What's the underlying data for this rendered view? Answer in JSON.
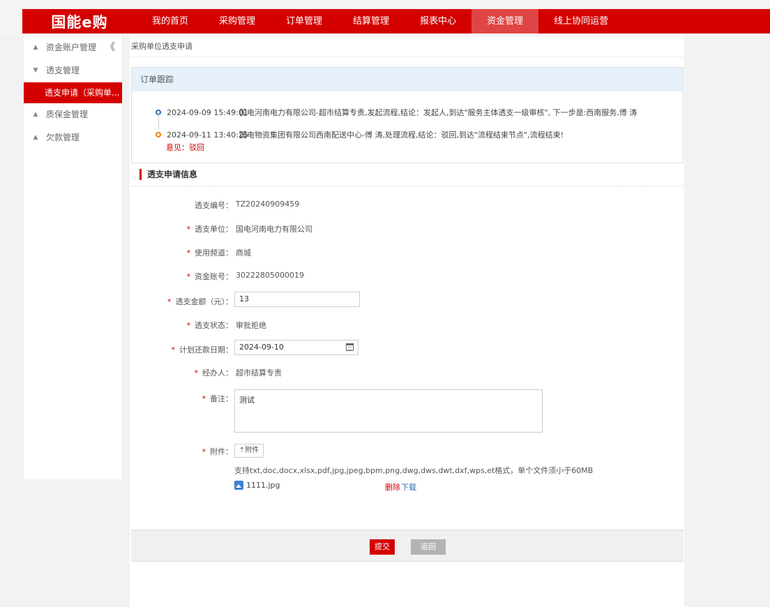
{
  "nav": {
    "logo": "国能e购",
    "items": [
      "我的首页",
      "采购管理",
      "订单管理",
      "结算管理",
      "报表中心",
      "资金管理",
      "线上协同运营"
    ],
    "active_index": 5
  },
  "sidebar": {
    "collapse_glyph": "《",
    "items": [
      {
        "label": "资金账户管理",
        "expanded": false
      },
      {
        "label": "透支管理",
        "expanded": true
      },
      {
        "label": "透支申请（采购单...",
        "sub": true,
        "active": true
      },
      {
        "label": "质保金管理",
        "expanded": false
      },
      {
        "label": "欠款管理",
        "expanded": false
      }
    ]
  },
  "breadcrumb": "采购单位透支申请",
  "tracking": {
    "title": "订单跟踪",
    "entries": [
      {
        "time": "2024-09-09 15:49:01",
        "text": "国电河南电力有限公司-超市结算专责,发起流程,结论：发起人,到达\"服务主体透支一级审核\", 下一步是:西南服务,傅 涛"
      },
      {
        "time": "2024-09-11 13:40:25",
        "text": "国电物资集团有限公司西南配送中心-傅 涛,处理流程,结论：驳回,到达\"流程结束节点\",流程结束!"
      }
    ],
    "opinion": "意见：驳回"
  },
  "form": {
    "section_title": "透支申请信息",
    "overdraft_no_label": "透支编号：",
    "overdraft_no": "TZ20240909459",
    "unit_label": "透支单位：",
    "unit": "国电河南电力有限公司",
    "channel_label": "使用频道：",
    "channel": "商城",
    "account_label": "资金账号：",
    "account": "30222805000019",
    "amount_label": "透支金额（元）：",
    "amount": "13",
    "status_label": "透支状态：",
    "status": "审批拒绝",
    "repay_date_label": "计划还款日期：",
    "repay_date": "2024-09-10",
    "handler_label": "经办人：",
    "handler": "超市结算专责",
    "remark_label": "备注：",
    "remark": "测试",
    "attach_label": "附件：",
    "attach_button": "附件",
    "attach_hint": "支持txt,doc,docx,xlsx,pdf,jpg,jpeg,bpm,png,dwg,dws,dwt,dxf,wps,et格式，单个文件须小于60MB",
    "file_name": "1111.jpg",
    "delete_link": "删除",
    "download_link": "下载"
  },
  "buttons": {
    "submit": "提交",
    "back": "返回"
  },
  "colors": {
    "brand": "#d40000",
    "link": "#2e6db5",
    "timeline_first": "#2e6db5",
    "timeline_second": "#f08000"
  }
}
